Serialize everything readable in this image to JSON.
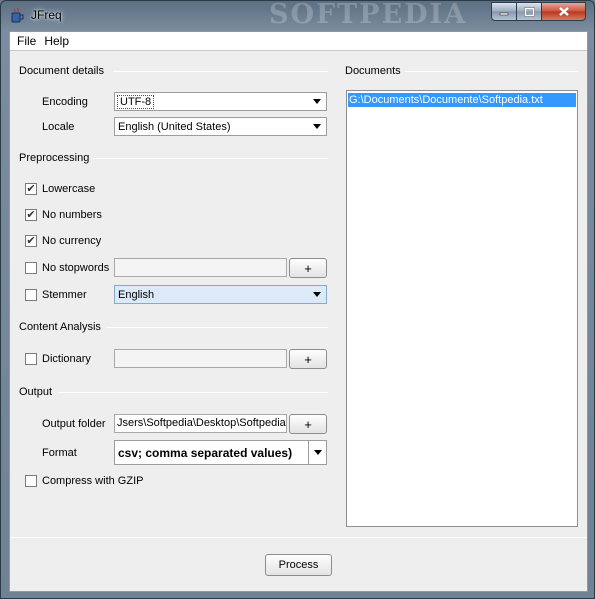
{
  "window": {
    "title": "JFreq",
    "watermark": "SOFTPEDIA"
  },
  "menubar": {
    "file": "File",
    "help": "Help"
  },
  "document_details": {
    "title": "Document details",
    "encoding_label": "Encoding",
    "encoding_value": "UTF-8",
    "locale_label": "Locale",
    "locale_value": "English (United States)"
  },
  "preprocessing": {
    "title": "Preprocessing",
    "lowercase": {
      "label": "Lowercase",
      "checked": true
    },
    "no_numbers": {
      "label": "No numbers",
      "checked": true
    },
    "no_currency": {
      "label": "No currency",
      "checked": true
    },
    "no_stopwords": {
      "label": "No stopwords",
      "checked": false
    },
    "stemmer": {
      "label": "Stemmer",
      "checked": false,
      "value": "English"
    },
    "add_label": "+"
  },
  "content_analysis": {
    "title": "Content Analysis",
    "dictionary": {
      "label": "Dictionary",
      "checked": false
    }
  },
  "output": {
    "title": "Output",
    "folder_label": "Output folder",
    "folder_value": "Jsers\\Softpedia\\Desktop\\Softpedia",
    "format_label": "Format",
    "format_value": "csv; comma separated values)",
    "gzip": {
      "label": "Compress with GZIP",
      "checked": false
    }
  },
  "documents": {
    "title": "Documents",
    "items": [
      "G:\\Documents\\Documente\\Softpedia.txt"
    ]
  },
  "process_label": "Process",
  "colors": {
    "selection": "#3399ff",
    "client_bg": "#eeeeee",
    "stemmer_bg": "#dce9f8"
  }
}
